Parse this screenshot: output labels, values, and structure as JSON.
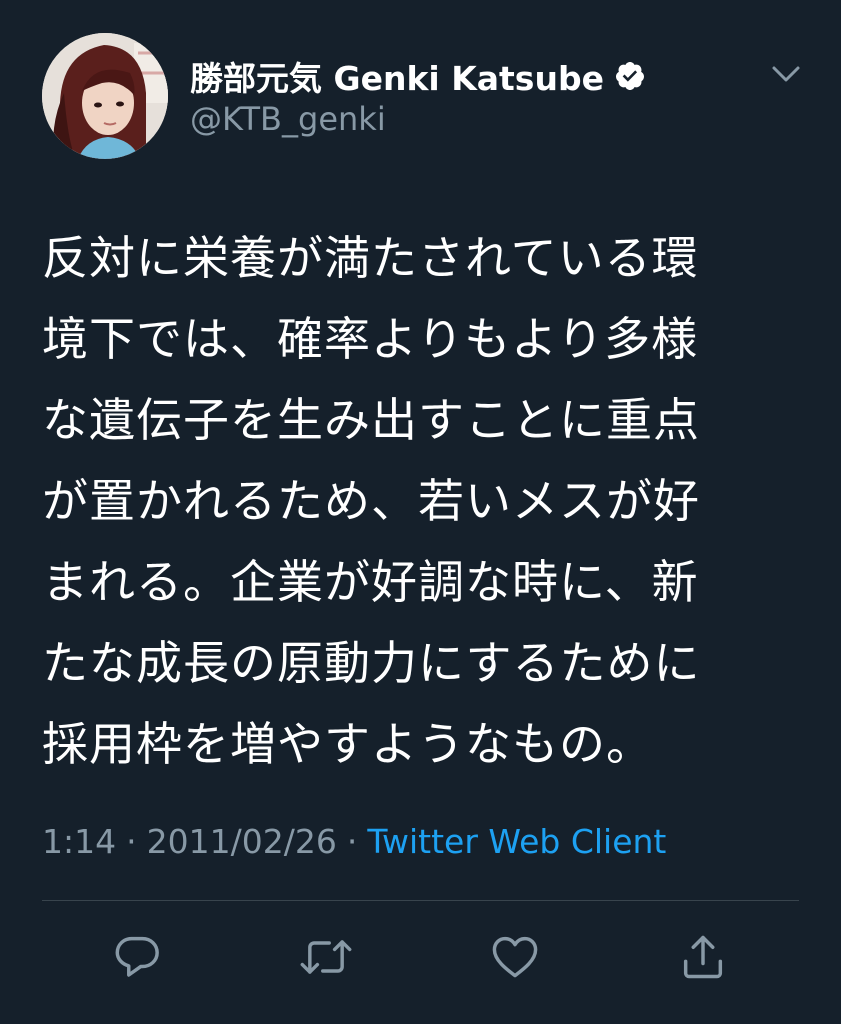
{
  "author": {
    "display_name": "勝部元気 Genki Katsube",
    "handle": "@KTB_genki",
    "verified": true
  },
  "tweet": {
    "lines": [
      "反対に栄養が満たされている環",
      "境下では、確率よりもより多様",
      "な遺伝子を生み出すことに重点",
      "が置かれるため、若いメスが好",
      "まれる。企業が好調な時に、新",
      "たな成長の原動力にするために",
      "採用枠を増やすようなもの。"
    ]
  },
  "meta": {
    "time": "1:14",
    "separator": "·",
    "date": "2011/02/26",
    "source": "Twitter Web Client"
  },
  "icons": {
    "verified": "verified-badge-icon",
    "menu": "chevron-down-icon",
    "reply": "reply-icon",
    "retweet": "retweet-icon",
    "like": "heart-icon",
    "share": "share-icon"
  },
  "colors": {
    "background": "#15202b",
    "text": "#ffffff",
    "secondary": "#8899a6",
    "link": "#1da1f2",
    "divider": "#38444d"
  }
}
